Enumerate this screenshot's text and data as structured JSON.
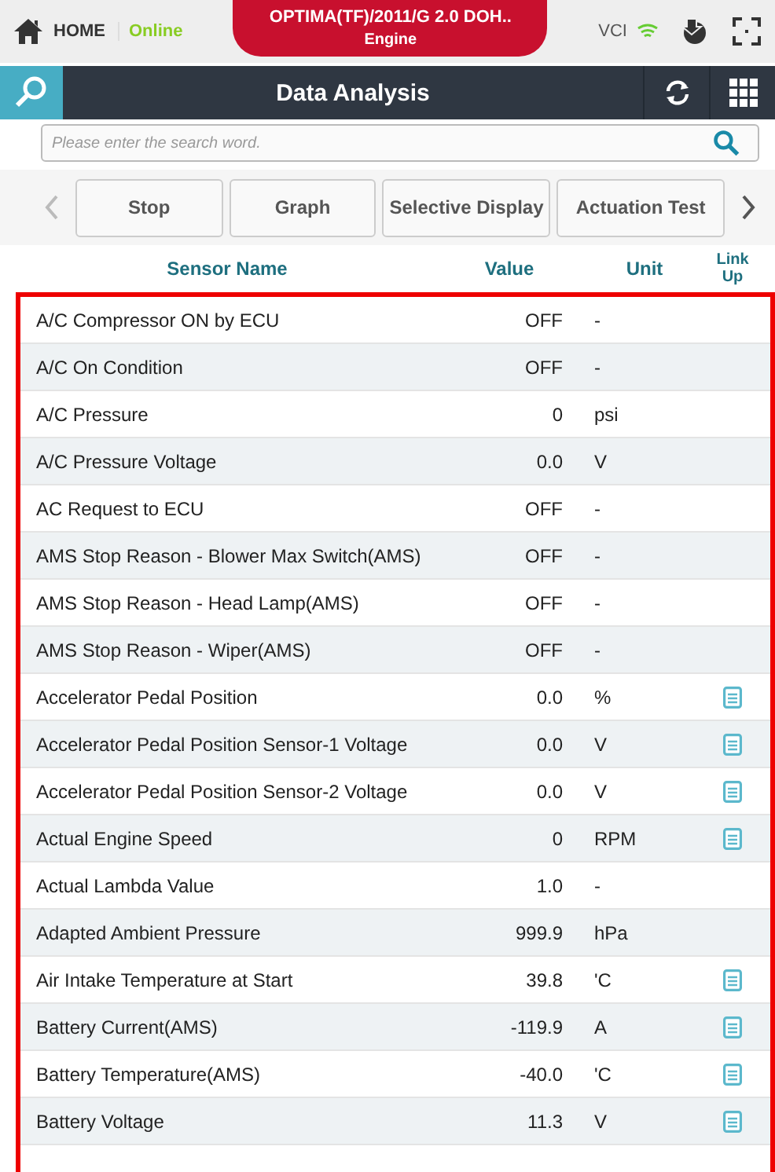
{
  "top_bar": {
    "home": "HOME",
    "status": "Online",
    "vehicle": "OPTIMA(TF)/2011/G 2.0 DOH..",
    "system": "Engine",
    "vci": "VCI"
  },
  "title_bar": {
    "title": "Data Analysis"
  },
  "search": {
    "placeholder": "Please enter the search word."
  },
  "toolbar": {
    "buttons": [
      "Stop",
      "Graph",
      "Selective Display",
      "Actuation Test"
    ]
  },
  "table": {
    "columns": [
      "Sensor Name",
      "Value",
      "Unit",
      "Link Up"
    ],
    "rows": [
      {
        "name": "A/C Compressor ON by ECU",
        "value": "OFF",
        "unit": "-",
        "link": false
      },
      {
        "name": "A/C On Condition",
        "value": "OFF",
        "unit": "-",
        "link": false
      },
      {
        "name": "A/C Pressure",
        "value": "0",
        "unit": "psi",
        "link": false
      },
      {
        "name": "A/C Pressure Voltage",
        "value": "0.0",
        "unit": "V",
        "link": false
      },
      {
        "name": "AC Request to ECU",
        "value": "OFF",
        "unit": "-",
        "link": false
      },
      {
        "name": "AMS Stop Reason - Blower Max Switch(AMS)",
        "value": "OFF",
        "unit": "-",
        "link": false
      },
      {
        "name": "AMS Stop Reason - Head Lamp(AMS)",
        "value": "OFF",
        "unit": "-",
        "link": false
      },
      {
        "name": "AMS Stop Reason - Wiper(AMS)",
        "value": "OFF",
        "unit": "-",
        "link": false
      },
      {
        "name": "Accelerator Pedal Position",
        "value": "0.0",
        "unit": "%",
        "link": true
      },
      {
        "name": "Accelerator Pedal Position Sensor-1 Voltage",
        "value": "0.0",
        "unit": "V",
        "link": true
      },
      {
        "name": "Accelerator Pedal Position Sensor-2 Voltage",
        "value": "0.0",
        "unit": "V",
        "link": true
      },
      {
        "name": "Actual Engine Speed",
        "value": "0",
        "unit": "RPM",
        "link": true
      },
      {
        "name": "Actual Lambda Value",
        "value": "1.0",
        "unit": "-",
        "link": false
      },
      {
        "name": "Adapted Ambient Pressure",
        "value": "999.9",
        "unit": "hPa",
        "link": false
      },
      {
        "name": "Air Intake Temperature at Start",
        "value": "39.8",
        "unit": "'C",
        "link": true
      },
      {
        "name": "Battery Current(AMS)",
        "value": "-119.9",
        "unit": "A",
        "link": true
      },
      {
        "name": "Battery Temperature(AMS)",
        "value": "-40.0",
        "unit": "'C",
        "link": true
      },
      {
        "name": "Battery Voltage",
        "value": "11.3",
        "unit": "V",
        "link": true
      }
    ]
  }
}
